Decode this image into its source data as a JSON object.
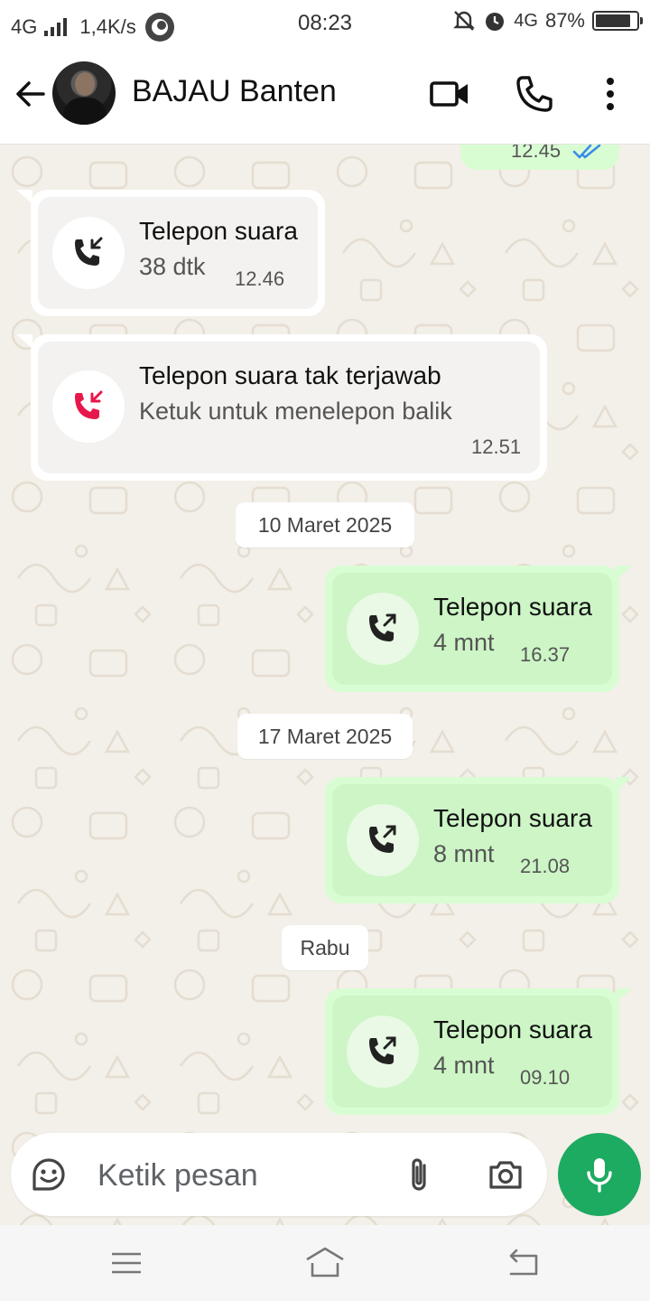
{
  "status_bar": {
    "network": "4G",
    "speed": "1,4K/s",
    "time": "08:23",
    "network_right": "4G",
    "battery": "87%",
    "battery_level": 0.87
  },
  "header": {
    "contact_name": "BAJAU Banten"
  },
  "messages": [
    {
      "type": "sent-partial",
      "time": "12.45"
    },
    {
      "type": "incoming-call",
      "title": "Telepon suara",
      "subtitle": "38 dtk",
      "time": "12.46"
    },
    {
      "type": "missed-call",
      "title": "Telepon suara tak terjawab",
      "subtitle": "Ketuk untuk menelepon balik",
      "time": "12.51"
    },
    {
      "type": "date",
      "label": "10 Maret 2025"
    },
    {
      "type": "outgoing-call",
      "title": "Telepon suara",
      "subtitle": "4 mnt",
      "time": "16.37"
    },
    {
      "type": "date",
      "label": "17 Maret 2025"
    },
    {
      "type": "outgoing-call",
      "title": "Telepon suara",
      "subtitle": "8 mnt",
      "time": "21.08"
    },
    {
      "type": "date",
      "label": "Rabu"
    },
    {
      "type": "outgoing-call",
      "title": "Telepon suara",
      "subtitle": "4 mnt",
      "time": "09.10"
    }
  ],
  "input": {
    "placeholder": "Ketik pesan"
  },
  "colors": {
    "outgoing_bubble": "#d9fdd3",
    "missed_call": "#e8174b",
    "mic_button": "#1daa61",
    "read_ticks": "#3b8ce8"
  },
  "icons": [
    "back-arrow-icon",
    "video-call-icon",
    "voice-call-icon",
    "more-options-icon",
    "sticker-icon",
    "attach-icon",
    "camera-icon",
    "mic-icon"
  ]
}
